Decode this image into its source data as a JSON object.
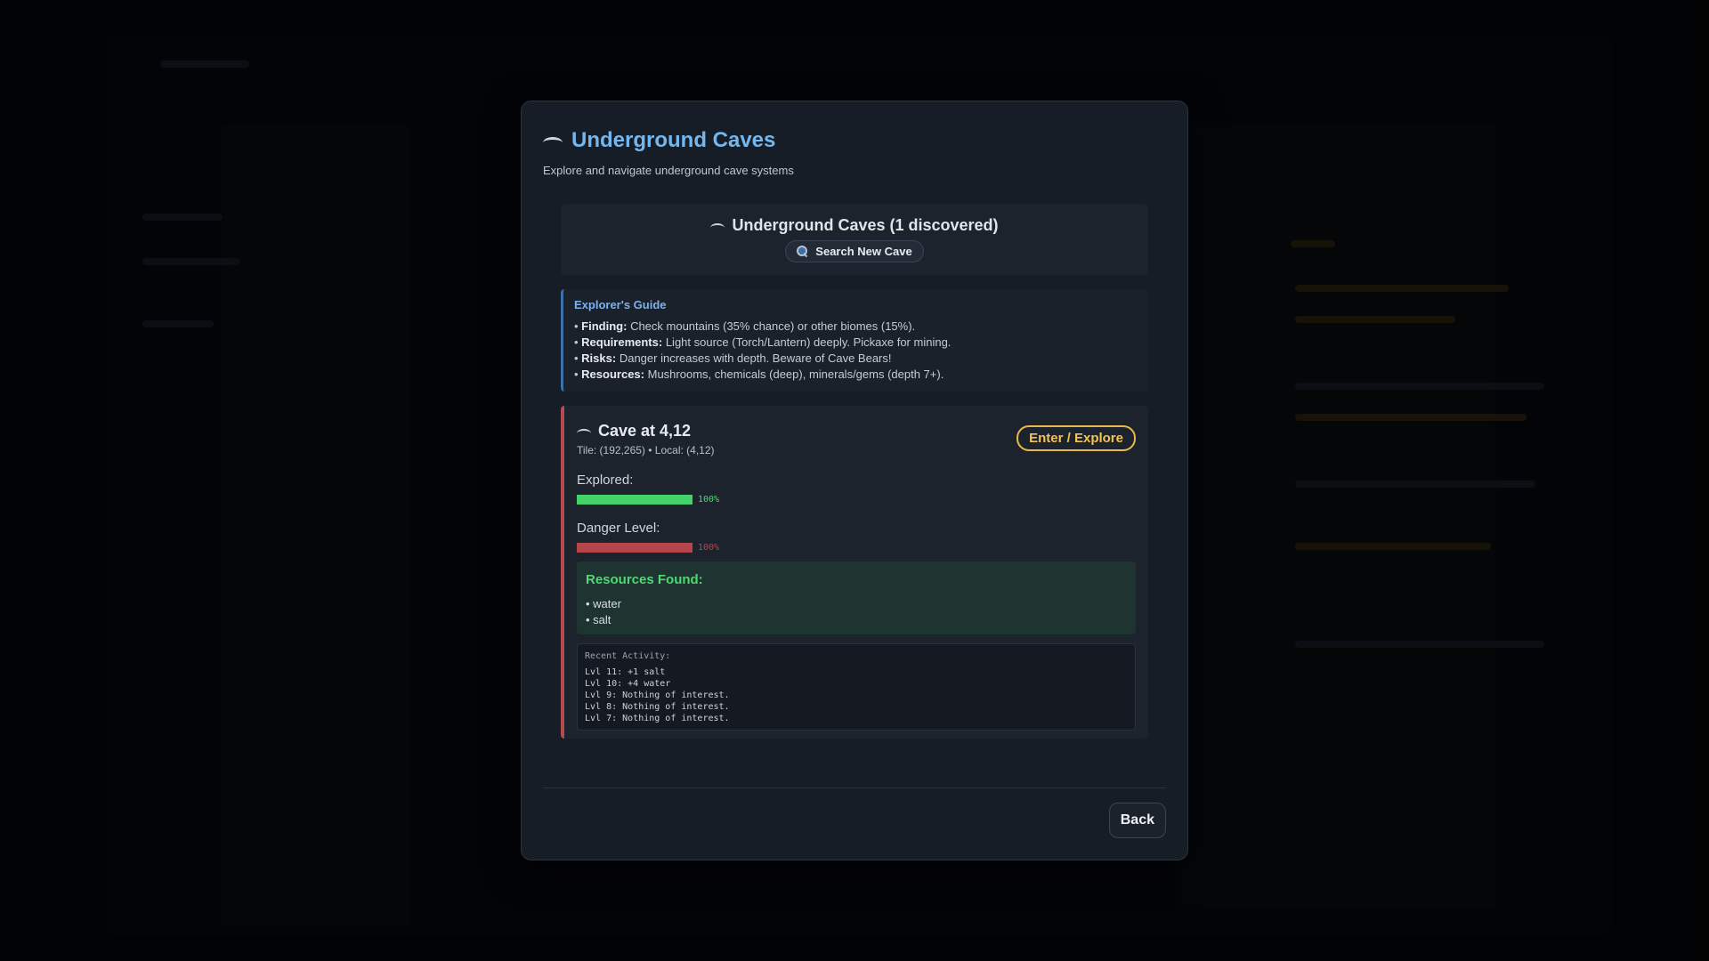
{
  "modal": {
    "title": "Underground Caves",
    "subtitle": "Explore and navigate underground cave systems",
    "title_icon": "cave-icon"
  },
  "caves_header": {
    "label": "Underground Caves (1 discovered)",
    "search_button": "Search New Cave",
    "search_icon": "magnifier-icon"
  },
  "guide": {
    "title": "Explorer's Guide",
    "items": [
      {
        "key": "Finding:",
        "text": "Check mountains (35% chance) or other biomes (15%)."
      },
      {
        "key": "Requirements:",
        "text": "Light source (Torch/Lantern) deeply. Pickaxe for mining."
      },
      {
        "key": "Risks:",
        "text": "Danger increases with depth. Beware of Cave Bears!"
      },
      {
        "key": "Resources:",
        "text": "Mushrooms, chemicals (deep), minerals/gems (depth 7+)."
      }
    ]
  },
  "cave": {
    "name": "Cave at 4,12",
    "meta": "Tile: (192,265) • Local: (4,12)",
    "enter_button": "Enter / Explore",
    "explored_label": "Explored:",
    "explored_pct": "100%",
    "explored_value": 100,
    "danger_label": "Danger Level:",
    "danger_pct": "100%",
    "danger_value": 100,
    "resources_title": "Resources Found:",
    "resources": [
      "• water",
      "• salt"
    ],
    "activity_title": "Recent Activity:",
    "activity": [
      "Lvl 11: +1 salt",
      "Lvl 10: +4 water",
      "Lvl 9: Nothing of interest.",
      "Lvl 8: Nothing of interest.",
      "Lvl 7: Nothing of interest."
    ]
  },
  "footer": {
    "back_button": "Back"
  },
  "colors": {
    "accent_title": "#74b7ee",
    "explored_bar": "#43d36a",
    "danger_bar": "#b5464c",
    "enter_button": "#f1c453",
    "card_border": "#b54a4f"
  }
}
